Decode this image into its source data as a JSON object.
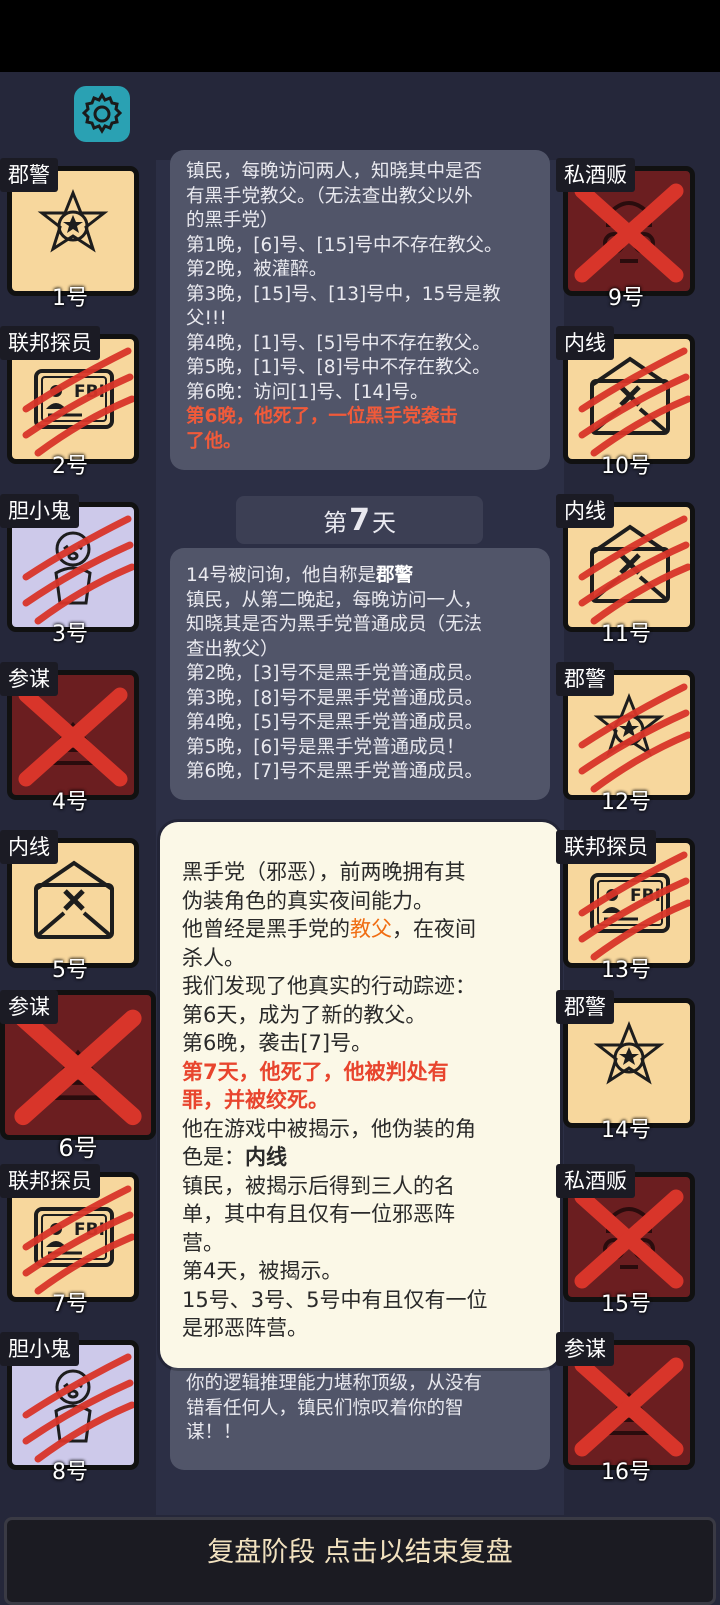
{
  "card_top": {
    "lines": [
      "镇民，每晚访问两人，知晓其中是否",
      "有黑手党教父。（无法查出教父以外",
      "的黑手党）",
      "第1晚，[6]号、[15]号中不存在教父。",
      "第2晚，被灌醉。",
      "第3晚，[15]号、[13]号中，15号是教",
      "父!!!",
      "第4晚，[1]号、[5]号中不存在教父。",
      "第5晚，[1]号、[8]号中不存在教父。",
      "第6晚：访问[1]号、[14]号。"
    ],
    "red_lines": [
      "第6晚，他死了，一位黑手党袭击",
      "了他。"
    ]
  },
  "day_bar": {
    "prefix": "第",
    "day": "7",
    "suffix": "天"
  },
  "card_mid": {
    "first_prefix": "14号被问询，他自称是",
    "first_role": "郡警",
    "lines": [
      "镇民，从第二晚起，每晚访问一人，",
      "知晓其是否为黑手党普通成员（无法",
      "查出教父）",
      "第2晚，[3]号不是黑手党普通成员。",
      "第3晚，[8]号不是黑手党普通成员。",
      "第4晚，[5]号不是黑手党普通成员。",
      "第5晚，[6]号是黑手党普通成员！",
      "第6晚，[7]号不是黑手党普通成员。"
    ]
  },
  "card_bottom": {
    "lines": [
      "你的逻辑推理能力堪称顶级，从没有",
      "错看任何人，镇民们惊叹着你的智",
      "谋！！"
    ]
  },
  "popup": {
    "l1": "黑手党（邪恶），前两晚拥有其",
    "l2": "伪装角色的真实夜间能力。",
    "l3_prefix": "他曾经是黑手党的",
    "l3_role": "教父",
    "l3_suffix": "，在夜间",
    "l4": "杀人。",
    "l5": "我们发现了他真实的行动踪迹：",
    "l6": "第6天，成为了新的教父。",
    "l7": "第6晚，袭击[7]号。",
    "l8": "第7天，他死了，他被判处有",
    "l9": "罪，并被绞死。",
    "l10": "他在游戏中被揭示，他伪装的角",
    "l11_prefix": "色是：",
    "l11_role": "内线",
    "l12": "镇民，被揭示后得到三人的名",
    "l13": "单，其中有且仅有一位邪恶阵",
    "l14": "营。",
    "l15": "第4天，被揭示。",
    "l16": "15号、3号、5号中有且仅有一位",
    "l17": "是邪恶阵营。"
  },
  "players": [
    {
      "role": "郡警",
      "num": "1号",
      "icon": "sheriff-badge-icon",
      "state": "alive"
    },
    {
      "role": "联邦探员",
      "num": "2号",
      "icon": "fbi-card-icon",
      "state": "clawed"
    },
    {
      "role": "胆小鬼",
      "num": "3号",
      "icon": "coward-icon",
      "state": "clawed"
    },
    {
      "role": "参谋",
      "num": "4号",
      "icon": "advisor-icon",
      "state": "crossed"
    },
    {
      "role": "内线",
      "num": "5号",
      "icon": "envelope-icon",
      "state": "alive"
    },
    {
      "role": "参谋",
      "num": "6号",
      "icon": "advisor-icon",
      "state": "crossed"
    },
    {
      "role": "联邦探员",
      "num": "7号",
      "icon": "fbi-card-icon",
      "state": "clawed"
    },
    {
      "role": "胆小鬼",
      "num": "8号",
      "icon": "coward-icon",
      "state": "clawed"
    },
    {
      "role": "私酒贩",
      "num": "9号",
      "icon": "bootlegger-icon",
      "state": "crossed"
    },
    {
      "role": "内线",
      "num": "10号",
      "icon": "envelope-icon",
      "state": "clawed"
    },
    {
      "role": "内线",
      "num": "11号",
      "icon": "envelope-icon",
      "state": "clawed"
    },
    {
      "role": "郡警",
      "num": "12号",
      "icon": "sheriff-badge-icon",
      "state": "clawed"
    },
    {
      "role": "联邦探员",
      "num": "13号",
      "icon": "fbi-card-icon",
      "state": "clawed"
    },
    {
      "role": "郡警",
      "num": "14号",
      "icon": "sheriff-badge-icon",
      "state": "alive"
    },
    {
      "role": "私酒贩",
      "num": "15号",
      "icon": "bootlegger-icon",
      "state": "crossed"
    },
    {
      "role": "参谋",
      "num": "16号",
      "icon": "advisor-icon",
      "state": "crossed"
    }
  ],
  "footer": {
    "label": "复盘阶段 点击以结束复盘"
  },
  "colors": {
    "background": "#25273a",
    "card": "#515569",
    "popup": "#fbf8e7",
    "red_text": "#f05a3a",
    "role_orange": "#f06d12",
    "claw_red": "#d8352a",
    "footer_text": "#f1e1bf"
  }
}
